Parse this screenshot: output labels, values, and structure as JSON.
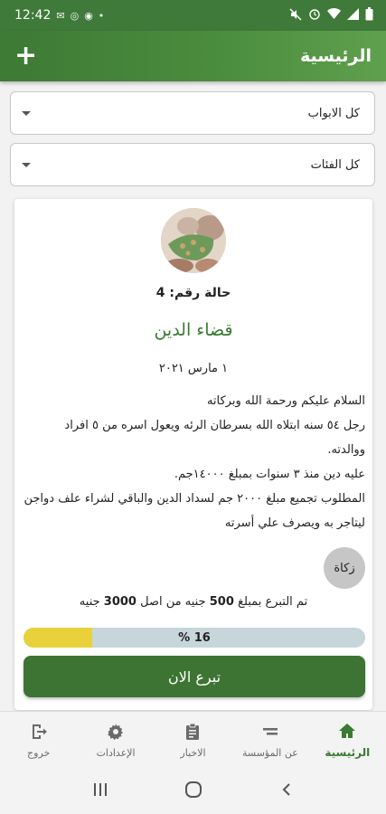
{
  "status_bar": {
    "time": "12:42",
    "dot": "•"
  },
  "app_bar": {
    "title": "الرئيسية",
    "add_label": "+"
  },
  "filters": {
    "sections": "كل الابواب",
    "categories": "كل الفئات"
  },
  "case": {
    "number_label": "حالة رقم:",
    "number": "4",
    "title": "قضاء الدين",
    "date": "١ مارس ٢٠٢١",
    "description": [
      "السلام عليكم ورحمة الله وبركاته",
      "رجل ٥٤ سنه ابتلاه الله بسرطان الرئه ويعول اسره من ٥ افراد ووالدته.",
      "عليه دين منذ ٣ سنوات بمبلغ ١٤٠٠٠جم.",
      "المطلوب تجميع مبلغ ٢٠٠٠ جم لسداد الدين والباقي لشراء علف دواجن ليتاجر به ويصرف علي أسرته"
    ],
    "tag": "زكاة",
    "donated_prefix": "تم التبرع بمبلغ",
    "donated_amount": "500",
    "donated_middle": "جنيه من اصل",
    "target_amount": "3000",
    "currency": "جنيه",
    "progress_fraction": 0.2,
    "progress_label": "16 %",
    "donate_button": "تبرع الان"
  },
  "bottom_nav": {
    "items": [
      {
        "label": "الرئيسية",
        "icon": "home-icon",
        "active": true
      },
      {
        "label": "عن المؤسسة",
        "icon": "equals-icon",
        "active": false
      },
      {
        "label": "الاخبار",
        "icon": "clipboard-icon",
        "active": false
      },
      {
        "label": "الإعدادات",
        "icon": "gear-icon",
        "active": false
      },
      {
        "label": "خروج",
        "icon": "logout-icon",
        "active": false
      }
    ]
  },
  "colors": {
    "primary": "#3d7a34",
    "accent_text": "#3a7a33",
    "progress_fill": "#e8d13a",
    "progress_track": "#c7d6db"
  }
}
